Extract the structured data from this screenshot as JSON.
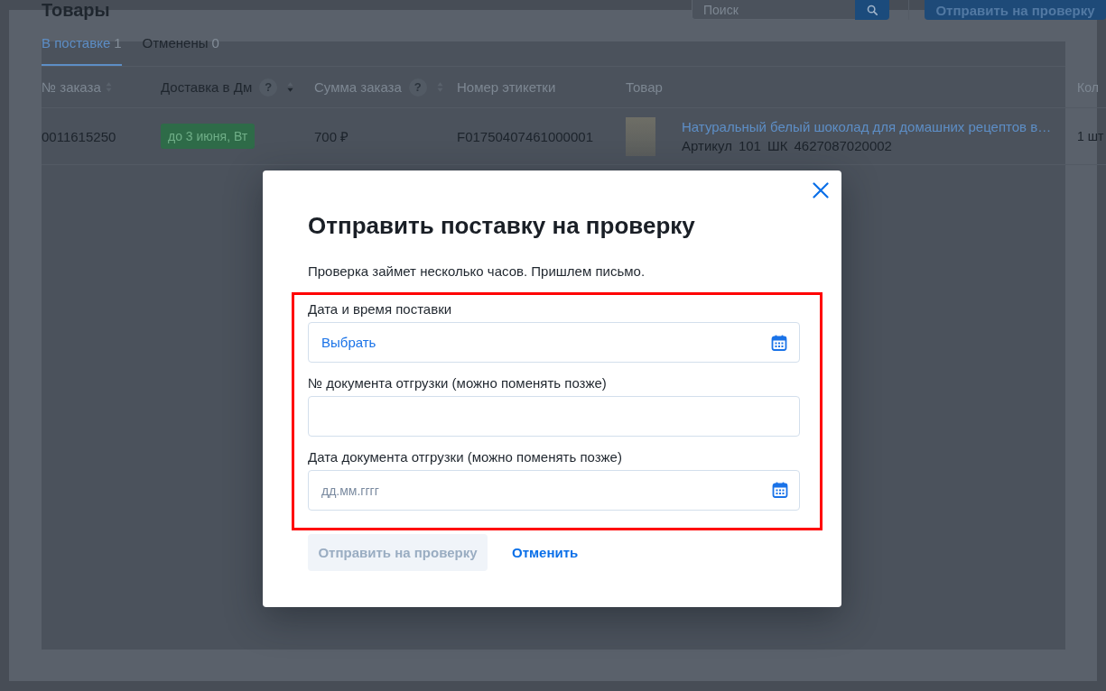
{
  "page": {
    "title": "Товары",
    "search": {
      "placeholder": "Поиск"
    },
    "submit_button": "Отправить на проверку"
  },
  "tabs": [
    {
      "label": "В поставке",
      "count": "1",
      "selected": true
    },
    {
      "label": "Отменены",
      "count": "0",
      "selected": false
    }
  ],
  "table": {
    "columns": [
      {
        "label": "№ заказа",
        "sortable": true,
        "sorted": false
      },
      {
        "label": "Доставка в Дм",
        "help": "?",
        "sortable": true,
        "sorted": true
      },
      {
        "label": "Сумма заказа",
        "help": "?",
        "sortable": true,
        "sorted": false
      },
      {
        "label": "Номер этикетки"
      },
      {
        "label": "Товар"
      },
      {
        "label": "Кол"
      }
    ],
    "rows": [
      {
        "order": "0011615250",
        "delivery": "до 3 июня, Вт",
        "sum": "700 ₽",
        "label_number": "F01750407461000001",
        "product": {
          "name": "Натуральный белый шоколад для домашних рецептов в…",
          "article_label": "Артикул",
          "article": "101",
          "barcode_label": "ШК",
          "barcode": "4627087020002"
        },
        "quantity": "1 шт"
      }
    ]
  },
  "dialog": {
    "title": "Отправить поставку на проверку",
    "text": "Проверка займет несколько часов. Пришлем письмо.",
    "highlighted": true,
    "fields": [
      {
        "kind": "picker",
        "label": "Дата и время поставки",
        "value": "Выбрать"
      },
      {
        "kind": "text",
        "label": "№ документа отгрузки (можно поменять позже)"
      },
      {
        "kind": "date",
        "label": "Дата документа отгрузки (можно поменять позже)",
        "placeholder": "дд.мм.гггг"
      }
    ],
    "buttons": [
      {
        "kind": "primary",
        "label": "Отправить на проверку",
        "disabled": true
      },
      {
        "kind": "link",
        "label": "Отменить",
        "disabled": false
      }
    ]
  }
}
